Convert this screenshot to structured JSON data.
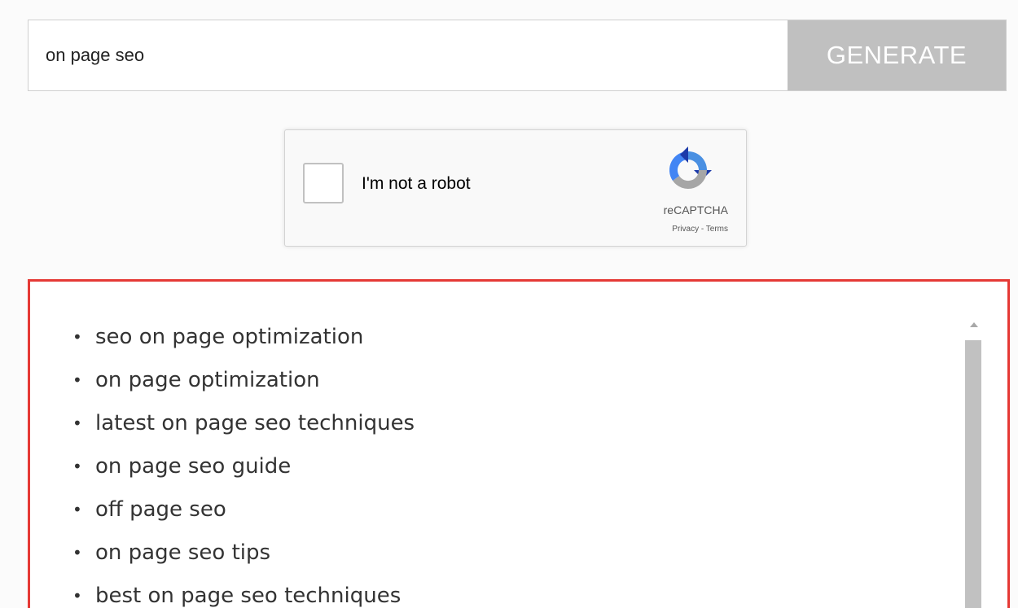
{
  "search": {
    "value": "on page seo",
    "button_label": "GENERATE"
  },
  "recaptcha": {
    "label": "I'm not a robot",
    "brand": "reCAPTCHA",
    "links": "Privacy - Terms",
    "logo_icon": "recaptcha-logo-icon"
  },
  "results": {
    "bullet": "•",
    "items": [
      "seo on page optimization",
      "on page optimization",
      "latest on page seo techniques",
      "on page seo guide",
      "off page seo",
      "on page seo tips",
      "best on page seo techniques"
    ]
  },
  "colors": {
    "results_border": "#e53935",
    "generate_button_bg": "#c0c0c0",
    "generate_button_text": "#ffffff"
  }
}
